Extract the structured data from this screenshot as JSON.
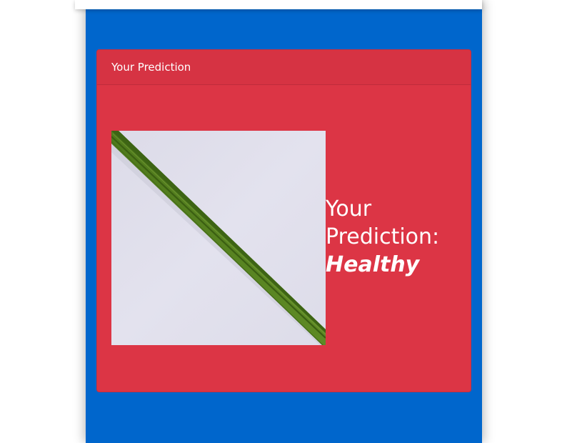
{
  "card": {
    "header_title": "Your Prediction"
  },
  "prediction": {
    "label_line1": "Your",
    "label_line2": "Prediction:",
    "result": "Healthy"
  },
  "image": {
    "subject": "leaf-photo"
  },
  "colors": {
    "panel_blue": "#0066cc",
    "card_red": "#dc3545",
    "text": "#ffffff"
  }
}
